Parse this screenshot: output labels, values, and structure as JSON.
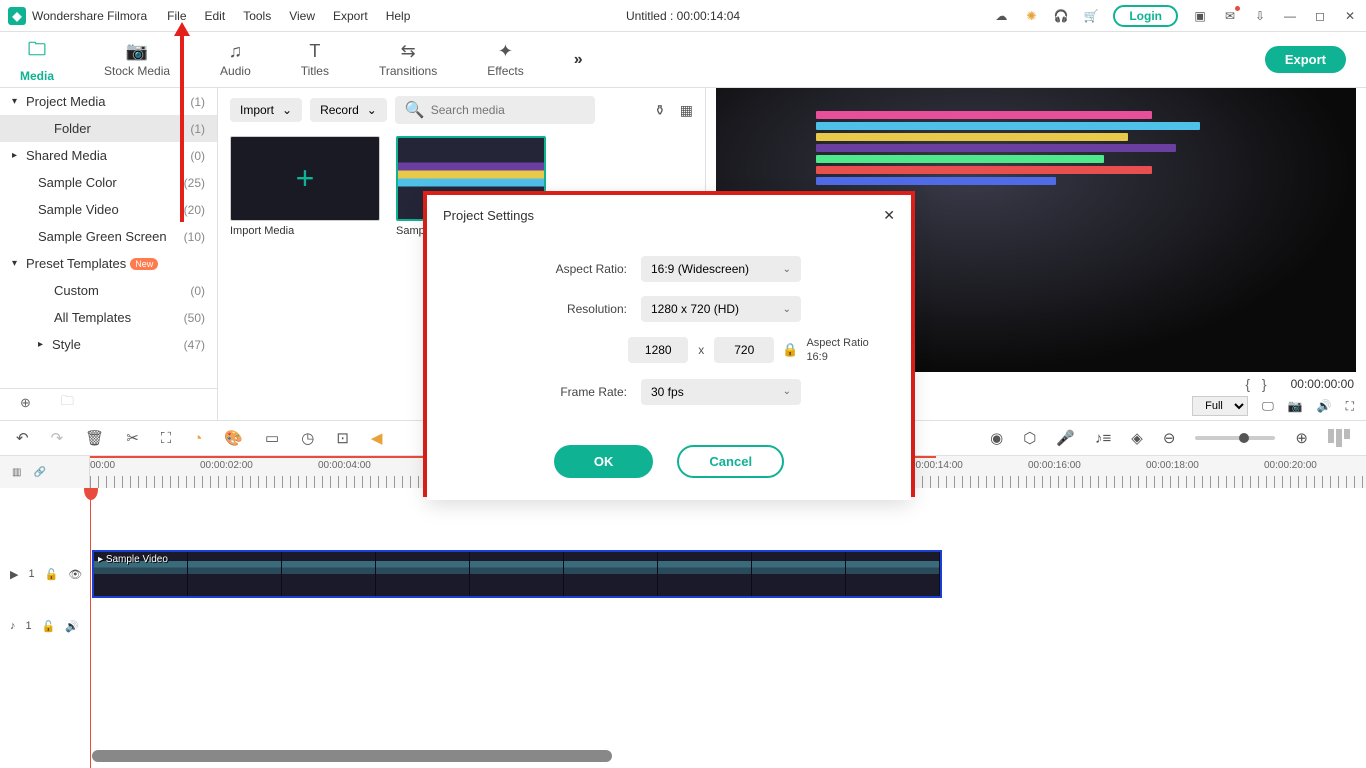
{
  "app_name": "Wondershare Filmora",
  "menu": {
    "file": "File",
    "edit": "Edit",
    "tools": "Tools",
    "view": "View",
    "export": "Export",
    "help": "Help"
  },
  "title_center": "Untitled : 00:00:14:04",
  "login": "Login",
  "tabs": {
    "media": "Media",
    "stock": "Stock Media",
    "audio": "Audio",
    "titles": "Titles",
    "transitions": "Transitions",
    "effects": "Effects"
  },
  "export_btn": "Export",
  "sidebar": {
    "project": {
      "label": "Project Media",
      "count": "(1)"
    },
    "folder": {
      "label": "Folder",
      "count": "(1)"
    },
    "shared": {
      "label": "Shared Media",
      "count": "(0)"
    },
    "sample_color": {
      "label": "Sample Color",
      "count": "(25)"
    },
    "sample_video": {
      "label": "Sample Video",
      "count": "(20)"
    },
    "sample_green": {
      "label": "Sample Green Screen",
      "count": "(10)"
    },
    "presets": {
      "label": "Preset Templates",
      "badge": "New"
    },
    "custom": {
      "label": "Custom",
      "count": "(0)"
    },
    "all": {
      "label": "All Templates",
      "count": "(50)"
    },
    "style": {
      "label": "Style",
      "count": "(47)"
    }
  },
  "media_panel": {
    "import": "Import",
    "record": "Record",
    "search_ph": "Search media",
    "thumb1": "Import Media",
    "thumb2": "Samp..."
  },
  "preview": {
    "full": "Full",
    "tc": "00:00:00:00",
    "braces": "{    }"
  },
  "ruler": [
    "00:00",
    "00:00:02:00",
    "00:00:04:00",
    "00:00:14:00",
    "00:00:16:00",
    "00:00:18:00",
    "00:00:20:00"
  ],
  "clip_label": "Sample Video",
  "track_v": "1",
  "track_a": "1",
  "dialog": {
    "title": "Project Settings",
    "aspect_l": "Aspect Ratio:",
    "aspect_v": "16:9 (Widescreen)",
    "res_l": "Resolution:",
    "res_v": "1280 x 720 (HD)",
    "res_w": "1280",
    "res_h": "720",
    "x": "x",
    "ar_side": "Aspect Ratio 16:9",
    "fps_l": "Frame Rate:",
    "fps_v": "30 fps",
    "ok": "OK",
    "cancel": "Cancel"
  }
}
